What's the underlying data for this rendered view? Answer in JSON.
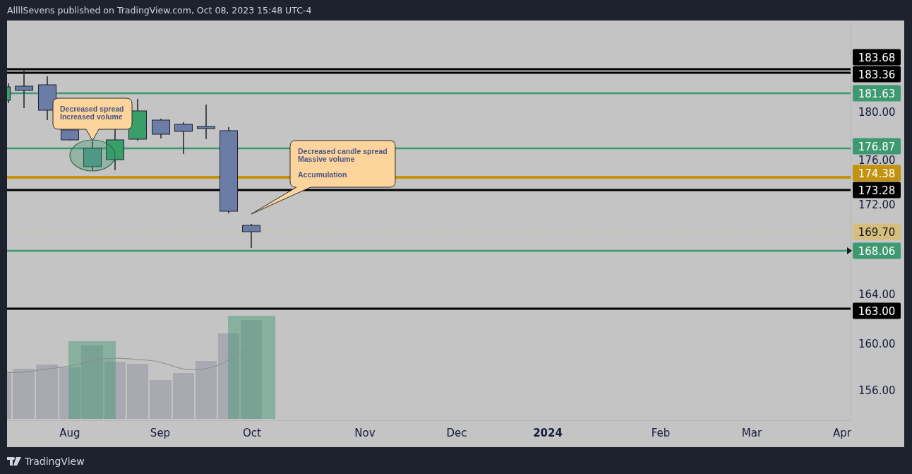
{
  "header": {
    "text": "AllllSevens published on TradingView.com, Oct 08, 2023 15:48 UTC-4"
  },
  "chart": {
    "price_ticks": [
      "180.00",
      "176.00",
      "172.00",
      "164.00",
      "160.00",
      "156.00"
    ],
    "levels": [
      {
        "label": "183.68",
        "color": "#000000",
        "kind": "line"
      },
      {
        "label": "183.36",
        "color": "#000000",
        "kind": "line"
      },
      {
        "label": "181.63",
        "color": "#3d9970",
        "kind": "line"
      },
      {
        "label": "176.87",
        "color": "#3d9970",
        "kind": "line"
      },
      {
        "label": "174.38",
        "color": "#c3920e",
        "kind": "line"
      },
      {
        "label": "173.28",
        "color": "#000000",
        "kind": "line"
      },
      {
        "label": "169.70",
        "color": "#d6bf7e",
        "kind": "last_price"
      },
      {
        "label": "168.06",
        "color": "#3d9970",
        "kind": "marked_line"
      },
      {
        "label": "163.00",
        "color": "#000000",
        "kind": "line"
      }
    ],
    "time_labels": [
      {
        "label": "Aug",
        "kind": "month"
      },
      {
        "label": "Sep",
        "kind": "month"
      },
      {
        "label": "Oct",
        "kind": "month"
      },
      {
        "label": "Nov",
        "kind": "month"
      },
      {
        "label": "Dec",
        "kind": "month"
      },
      {
        "label": "2024",
        "kind": "year"
      },
      {
        "label": "Feb",
        "kind": "month"
      },
      {
        "label": "Mar",
        "kind": "month"
      },
      {
        "label": "Apr",
        "kind": "month"
      }
    ],
    "callouts": [
      {
        "text": "Decreased spread\nIncreased volume"
      },
      {
        "text": "Decreased candle spread\nMassive volume\n\nAccumulation"
      }
    ]
  },
  "footer": {
    "brand": "TradingView"
  }
}
